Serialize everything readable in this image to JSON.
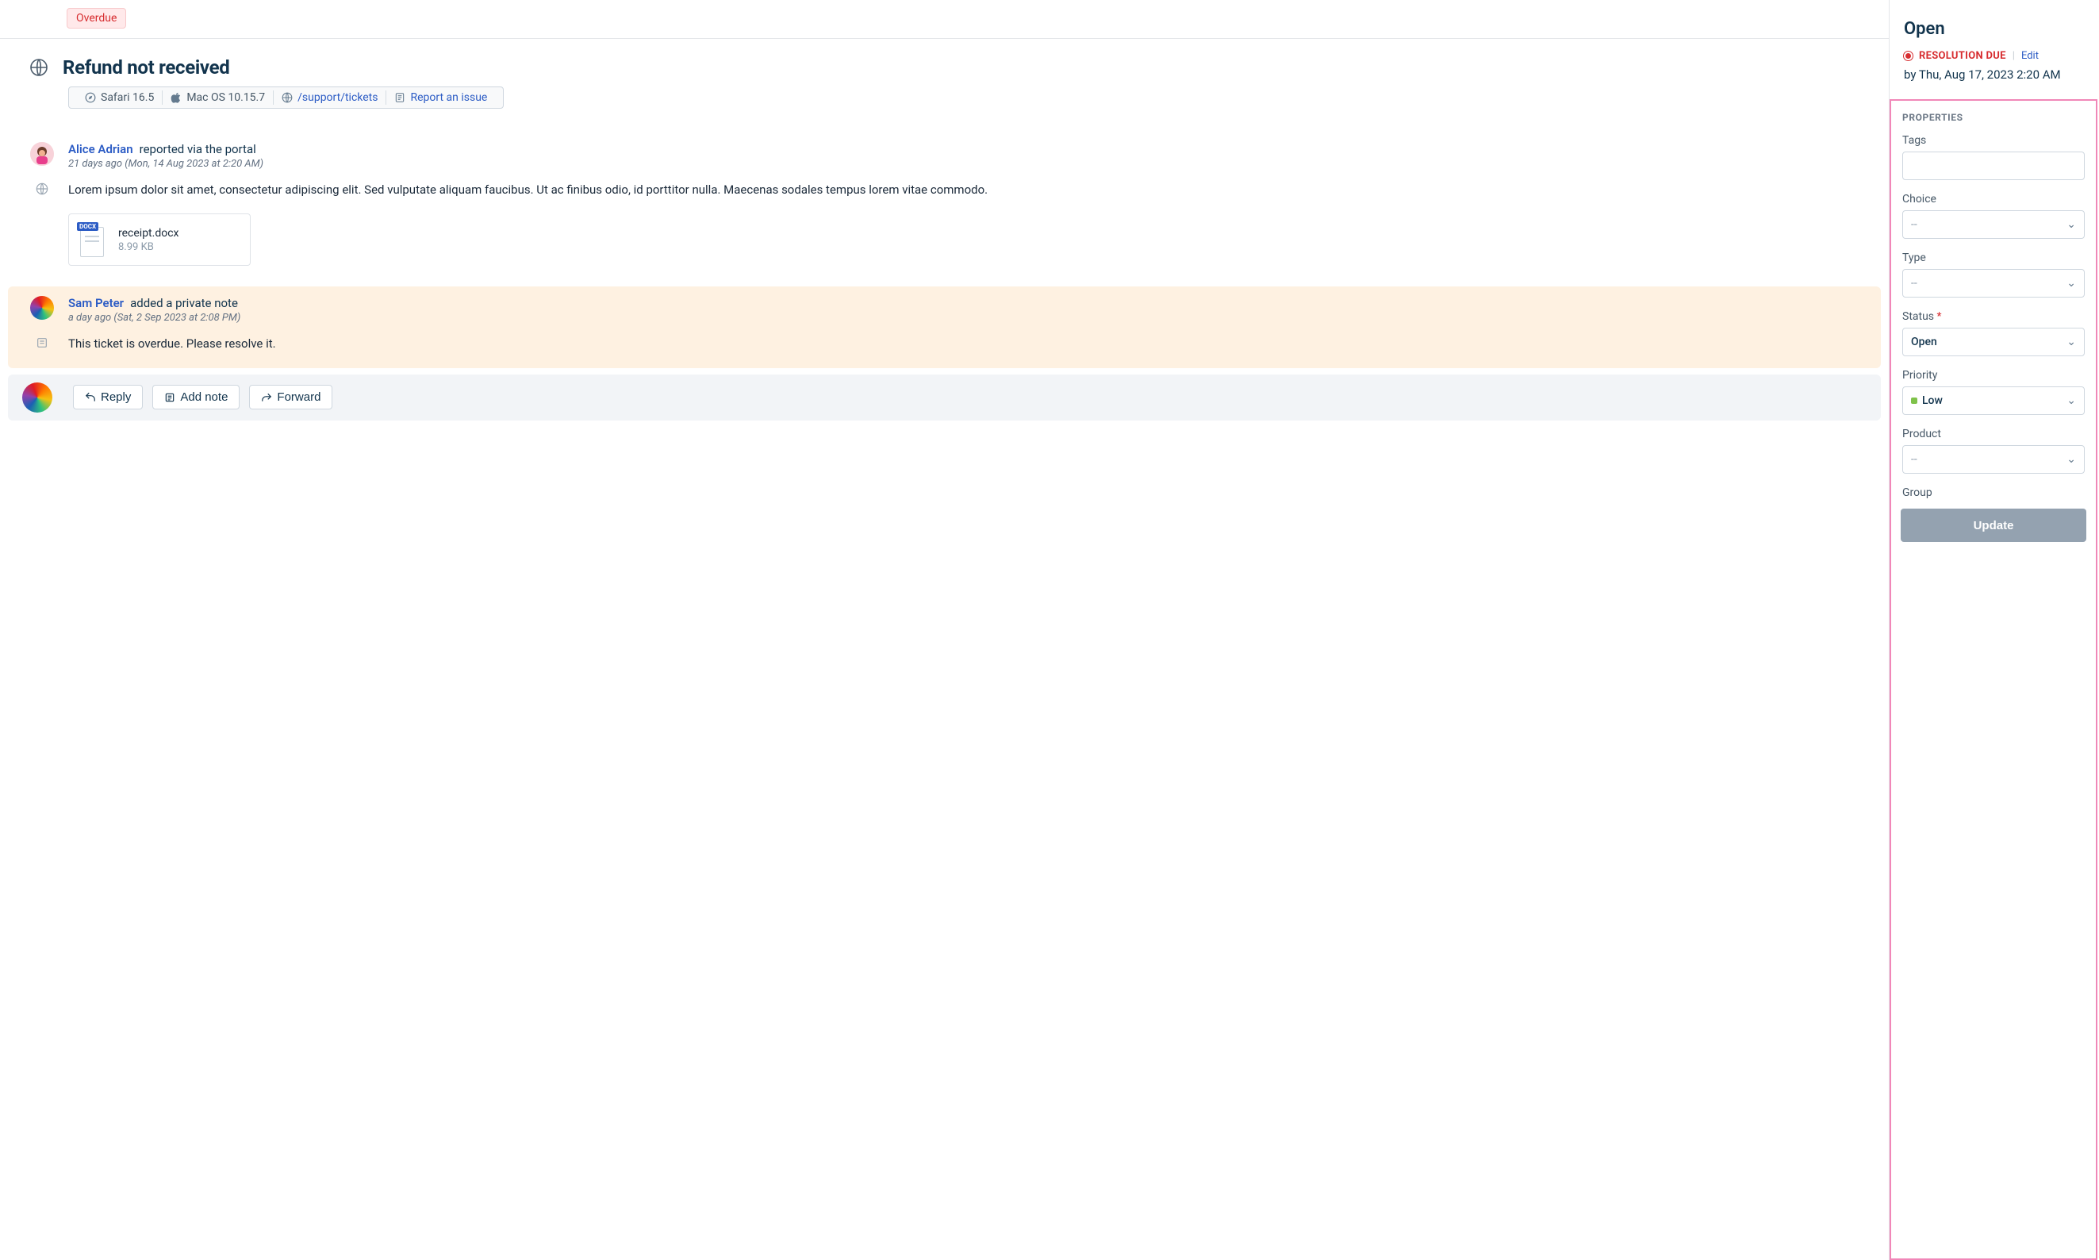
{
  "header": {
    "overdue_badge": "Overdue",
    "title": "Refund not received",
    "meta": {
      "browser": "Safari 16.5",
      "os": "Mac OS 10.15.7",
      "path": "/support/tickets",
      "report": "Report an issue"
    }
  },
  "thread": {
    "first": {
      "author": "Alice Adrian",
      "action": "reported via the portal",
      "time": "21 days ago (Mon, 14 Aug 2023 at 2:20 AM)",
      "body": "Lorem ipsum dolor sit amet, consectetur adipiscing elit. Sed vulputate aliquam faucibus. Ut ac finibus odio, id porttitor nulla. Maecenas sodales tempus lorem vitae commodo.",
      "attachment": {
        "name": "receipt.docx",
        "size": "8.99 KB",
        "badge": "DOCX"
      }
    },
    "note": {
      "author": "Sam Peter",
      "action": "added a private note",
      "time": "a day ago (Sat, 2 Sep 2023 at 2:08 PM)",
      "body": "This ticket is overdue. Please resolve it."
    }
  },
  "actions": {
    "reply": "Reply",
    "add_note": "Add note",
    "forward": "Forward"
  },
  "side": {
    "status_title": "Open",
    "resolution_label": "RESOLUTION DUE",
    "edit": "Edit",
    "due_time": "by Thu, Aug 17, 2023 2:20 AM",
    "properties_title": "PROPERTIES",
    "fields": {
      "tags_label": "Tags",
      "choice_label": "Choice",
      "choice_value": "--",
      "type_label": "Type",
      "type_value": "--",
      "status_label": "Status",
      "status_value": "Open",
      "priority_label": "Priority",
      "priority_value": "Low",
      "product_label": "Product",
      "product_value": "--",
      "group_label": "Group"
    },
    "update": "Update"
  }
}
